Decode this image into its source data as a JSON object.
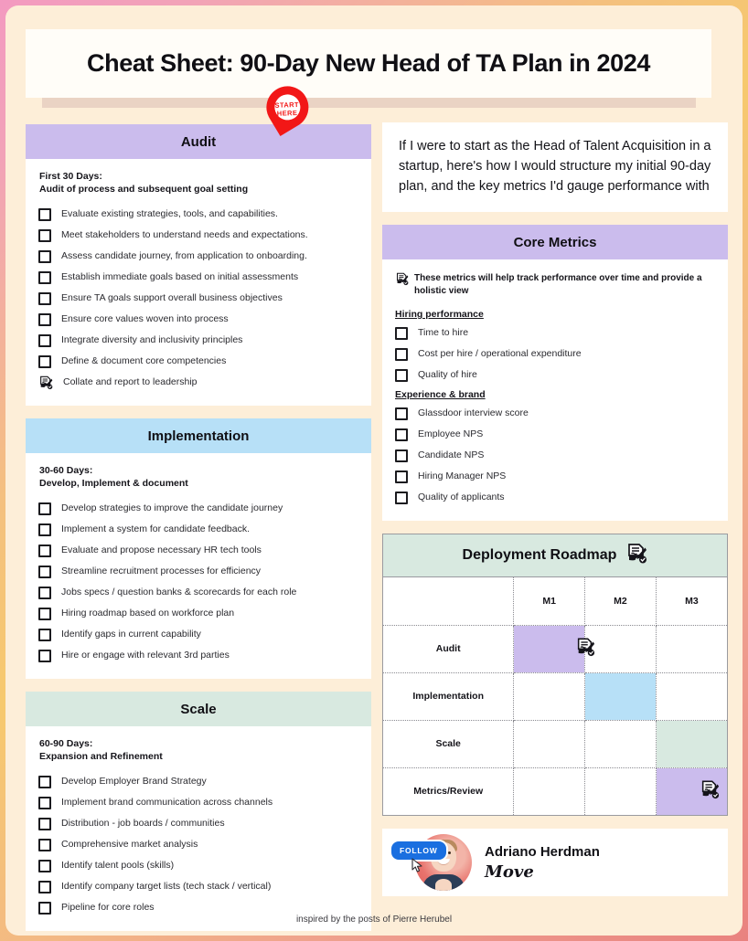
{
  "title": "Cheat Sheet: 90-Day New Head of TA Plan in 2024",
  "pin": {
    "line1": "START",
    "line2": "HERE"
  },
  "intro": "If I were to start as the Head of Talent Acquisition in a startup, here's how I would structure my initial 90-day plan, and the key metrics I'd gauge performance with",
  "left": {
    "audit": {
      "heading": "Audit",
      "sub_line1": "First 30 Days:",
      "sub_line2": "Audit of process and subsequent goal setting",
      "items": [
        {
          "label": "Evaluate existing strategies, tools, and capabilities.",
          "icon": "checkbox"
        },
        {
          "label": "Meet stakeholders to understand needs and expectations.",
          "icon": "checkbox"
        },
        {
          "label": "Assess candidate journey, from application to onboarding.",
          "icon": "checkbox"
        },
        {
          "label": "Establish immediate goals based on initial assessments",
          "icon": "checkbox"
        },
        {
          "label": "Ensure TA goals support overall business objectives",
          "icon": "checkbox"
        },
        {
          "label": "Ensure core values woven into process",
          "icon": "checkbox"
        },
        {
          "label": "Integrate diversity and inclusivity principles",
          "icon": "checkbox"
        },
        {
          "label": "Define & document core competencies",
          "icon": "checkbox"
        },
        {
          "label": "Collate and report to leadership",
          "icon": "document-pen"
        }
      ]
    },
    "implementation": {
      "heading": "Implementation",
      "sub_line1": "30-60 Days:",
      "sub_line2": "Develop, Implement & document",
      "items": [
        {
          "label": "Develop strategies to improve the candidate journey",
          "icon": "checkbox"
        },
        {
          "label": "Implement a system for candidate feedback.",
          "icon": "checkbox"
        },
        {
          "label": "Evaluate and propose necessary HR tech tools",
          "icon": "checkbox"
        },
        {
          "label": "Streamline recruitment processes for efficiency",
          "icon": "checkbox"
        },
        {
          "label": "Jobs specs / question banks & scorecards for each role",
          "icon": "checkbox"
        },
        {
          "label": "Hiring roadmap based on workforce plan",
          "icon": "checkbox"
        },
        {
          "label": "Identify gaps in current capability",
          "icon": "checkbox"
        },
        {
          "label": "Hire or engage with relevant 3rd parties",
          "icon": "checkbox"
        }
      ]
    },
    "scale": {
      "heading": "Scale",
      "sub_line1": "60-90 Days:",
      "sub_line2": "Expansion and Refinement",
      "items": [
        {
          "label": "Develop Employer Brand Strategy",
          "icon": "checkbox"
        },
        {
          "label": "Implement brand communication across channels",
          "icon": "checkbox"
        },
        {
          "label": "Distribution - job boards / communities",
          "icon": "checkbox"
        },
        {
          "label": "Comprehensive market analysis",
          "icon": "checkbox"
        },
        {
          "label": "Identify talent pools (skills)",
          "icon": "checkbox"
        },
        {
          "label": "Identify company target lists (tech stack / vertical)",
          "icon": "checkbox"
        },
        {
          "label": "Pipeline for core roles",
          "icon": "checkbox"
        }
      ]
    }
  },
  "right": {
    "core_metrics": {
      "heading": "Core Metrics",
      "note": "These metrics will help track performance over time and provide a holistic view",
      "groups": [
        {
          "title": "Hiring performance",
          "items": [
            {
              "label": "Time to hire",
              "icon": "checkbox"
            },
            {
              "label": "Cost per hire  / operational expenditure",
              "icon": "checkbox"
            },
            {
              "label": "Quality of hire",
              "icon": "checkbox"
            }
          ]
        },
        {
          "title": "Experience & brand",
          "items": [
            {
              "label": "Glassdoor interview score",
              "icon": "checkbox"
            },
            {
              "label": "Employee NPS",
              "icon": "checkbox"
            },
            {
              "label": "Candidate NPS",
              "icon": "checkbox"
            },
            {
              "label": "Hiring Manager NPS",
              "icon": "checkbox"
            },
            {
              "label": "Quality of applicants",
              "icon": "checkbox"
            }
          ]
        }
      ]
    },
    "roadmap": {
      "heading": "Deployment Roadmap",
      "columns": [
        "",
        "M1",
        "M2",
        "M3"
      ],
      "rows": [
        {
          "label": "Audit",
          "cells": [
            "purple",
            "",
            ""
          ],
          "icon_col": 1,
          "icon": "document-pen"
        },
        {
          "label": "Implementation",
          "cells": [
            "",
            "blue",
            ""
          ],
          "icon_col": -1,
          "icon": ""
        },
        {
          "label": "Scale",
          "cells": [
            "",
            "",
            "green"
          ],
          "icon_col": -1,
          "icon": ""
        },
        {
          "label": "Metrics/Review",
          "cells": [
            "",
            "",
            "purple"
          ],
          "icon_col": 3,
          "icon": "document-pen"
        }
      ]
    },
    "author": {
      "follow_label": "FOLLOW",
      "name": "Adriano Herdman",
      "brand": "Move"
    }
  },
  "footer": "inspired by the posts of Pierre Herubel",
  "colors": {
    "purple": "#cbbced",
    "blue": "#b7e0f7",
    "green": "#d8e9e0",
    "page_bg": "#fdeed8",
    "pin_red": "#f21717",
    "follow_blue": "#1a6fe0"
  }
}
